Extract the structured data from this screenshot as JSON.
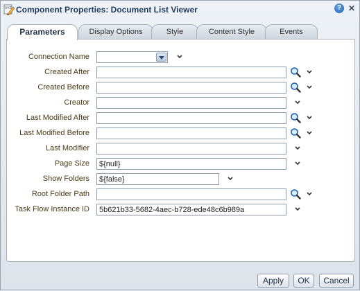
{
  "window": {
    "title": "Component Properties: Document List Viewer",
    "help_label": "?",
    "close_label": "✕"
  },
  "tabs": [
    {
      "label": "Parameters",
      "active": true
    },
    {
      "label": "Display Options",
      "active": false
    },
    {
      "label": "Style",
      "active": false
    },
    {
      "label": "Content Style",
      "active": false
    },
    {
      "label": "Events",
      "active": false
    }
  ],
  "parameters": [
    {
      "label": "Connection Name",
      "value": "",
      "type": "select",
      "search": false
    },
    {
      "label": "Created After",
      "value": "",
      "type": "text",
      "search": true
    },
    {
      "label": "Created Before",
      "value": "",
      "type": "text",
      "search": true
    },
    {
      "label": "Creator",
      "value": "",
      "type": "text",
      "search": false
    },
    {
      "label": "Last Modified After",
      "value": "",
      "type": "text",
      "search": true
    },
    {
      "label": "Last Modified Before",
      "value": "",
      "type": "text",
      "search": true
    },
    {
      "label": "Last Modifier",
      "value": "",
      "type": "text",
      "search": false
    },
    {
      "label": "Page Size",
      "value": "${null}",
      "type": "text",
      "search": false
    },
    {
      "label": "Show Folders",
      "value": "${false}",
      "type": "text-short",
      "search": false
    },
    {
      "label": "Root Folder Path",
      "value": "",
      "type": "text",
      "search": true
    },
    {
      "label": "Task Flow Instance ID",
      "value": "5b621b33-5682-4aec-b728-ede48c6b989a",
      "type": "text",
      "search": false
    }
  ],
  "footer": {
    "apply_label": "Apply",
    "ok_label": "OK",
    "cancel_label": "Cancel"
  },
  "icons": {
    "app": "edit-pencil-icon",
    "search": "search-magnifier-icon",
    "chevron": "chevron-down-icon"
  },
  "colors": {
    "label_text": "#4a3b16",
    "title_text": "#1f3a5e",
    "panel_bg": "#ffffff",
    "dialog_bg": "#e9edf2"
  }
}
